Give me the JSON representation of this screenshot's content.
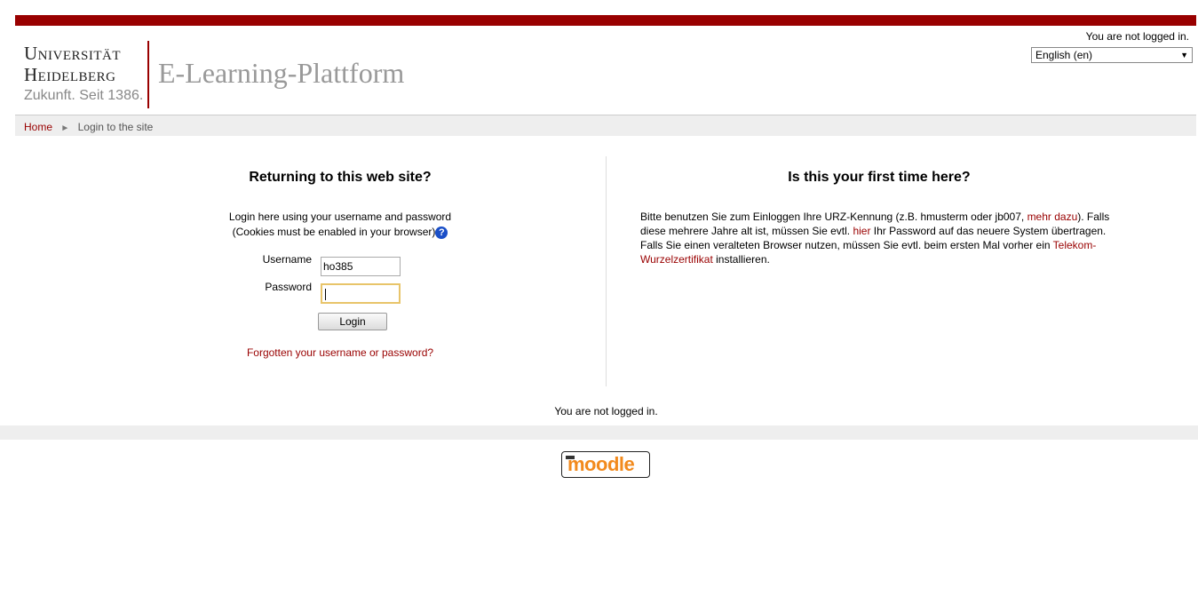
{
  "header": {
    "logo_line1": "Universität",
    "logo_line2": "Heidelberg",
    "logo_line3": "Zukunft. Seit 1386.",
    "site_title": "E-Learning-Plattform",
    "login_status": "You are not logged in.",
    "language_select": "English (en)",
    "brand_color": "#990000"
  },
  "breadcrumb": {
    "home": "Home",
    "separator": "►",
    "current": "Login to the site"
  },
  "login": {
    "title": "Returning to this web site?",
    "desc_line1": "Login here using your username and password",
    "desc_line2": "(Cookies must be enabled in your browser)",
    "help_icon": "?",
    "username_label": "Username",
    "username_value": "ho385",
    "password_label": "Password",
    "password_value": "",
    "login_button": "Login",
    "forgot_link": "Forgotten your username or password?"
  },
  "signup": {
    "title": "Is this your first time here?",
    "text_part1": "Bitte benutzen Sie zum Einloggen Ihre URZ-Kennung (z.B. hmusterm oder jb007, ",
    "link_mehr": "mehr dazu",
    "text_part2": "). Falls diese mehrere Jahre alt ist, müssen Sie evtl. ",
    "link_hier": "hier",
    "text_part3": " Ihr Password auf das neuere System übertragen. Falls Sie einen veralteten Browser nutzen, müssen Sie evtl. beim ersten Mal vorher ein ",
    "link_cert": "Telekom-Wurzelzertifikat",
    "text_part4": " installieren."
  },
  "footer": {
    "login_status": "You are not logged in.",
    "moodle_logo": "moodle"
  }
}
